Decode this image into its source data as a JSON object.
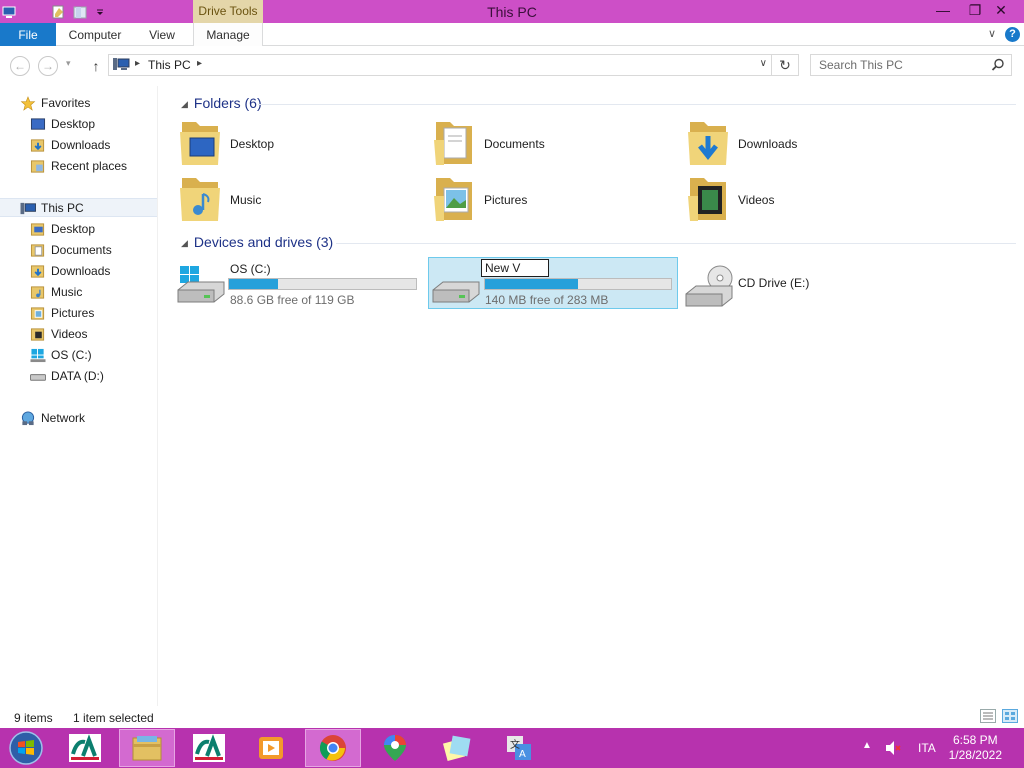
{
  "window": {
    "title": "This PC",
    "context_tab": "Drive Tools",
    "minimize": "—",
    "restore": "❐",
    "close": "✕"
  },
  "ribbon": {
    "tabs": [
      "File",
      "Computer",
      "View",
      "Manage"
    ],
    "help": "?",
    "expander": "∨"
  },
  "nav": {
    "back": "←",
    "forward": "→",
    "up": "↑",
    "breadcrumb": "This PC",
    "refresh": "↻"
  },
  "search": {
    "placeholder": "Search This PC"
  },
  "navpane": {
    "favorites": {
      "label": "Favorites",
      "items": [
        "Desktop",
        "Downloads",
        "Recent places"
      ]
    },
    "thispc": {
      "label": "This PC",
      "items": [
        "Desktop",
        "Documents",
        "Downloads",
        "Music",
        "Pictures",
        "Videos",
        "OS (C:)",
        "DATA (D:)"
      ]
    },
    "network": {
      "label": "Network"
    }
  },
  "content": {
    "folders_header": "Folders (6)",
    "folders": [
      "Desktop",
      "Documents",
      "Downloads",
      "Music",
      "Pictures",
      "Videos"
    ],
    "devices_header": "Devices and drives (3)",
    "drives": [
      {
        "name": "OS (C:)",
        "free": "88.6 GB free of 119 GB",
        "used_fraction": 0.26
      },
      {
        "name": "New V",
        "free": "140 MB free of 283 MB",
        "used_fraction": 0.5
      },
      {
        "name": "CD Drive (E:)"
      }
    ]
  },
  "status": {
    "items": "9 items",
    "selected": "1 item selected"
  },
  "taskbar": {
    "language": "ITA",
    "time": "6:58 PM",
    "date": "1/28/2022",
    "tray_arrow": "▲"
  },
  "colors": {
    "titlebar": "#cd4fc7",
    "taskbar": "#b732ae",
    "accent": "#1979ca",
    "selection": "#cce8f4",
    "progress": "#26a0da"
  }
}
